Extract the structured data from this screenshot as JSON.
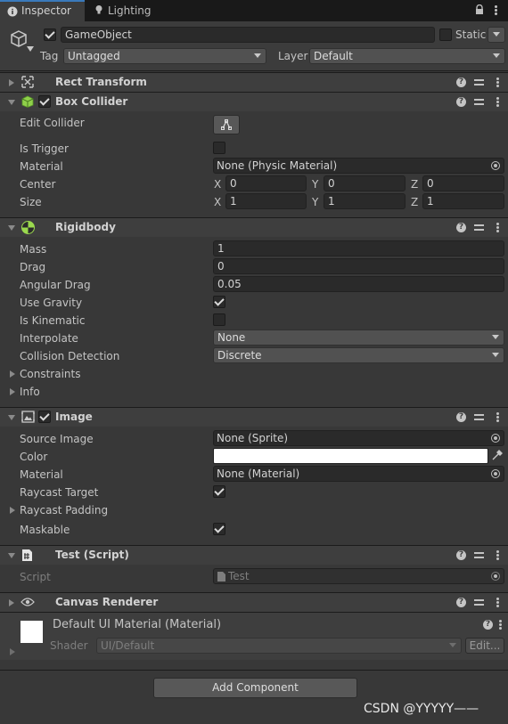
{
  "tabs": [
    {
      "label": "Inspector",
      "icon": "info-icon",
      "active": true
    },
    {
      "label": "Lighting",
      "icon": "lightbulb-icon",
      "active": false
    }
  ],
  "header": {
    "name": "GameObject",
    "static_label": "Static",
    "tag_label": "Tag",
    "tag_value": "Untagged",
    "layer_label": "Layer",
    "layer_value": "Default"
  },
  "rect_transform": {
    "title": "Rect Transform"
  },
  "box_collider": {
    "title": "Box Collider",
    "edit_collider": "Edit Collider",
    "is_trigger": "Is Trigger",
    "material_label": "Material",
    "material_value": "None (Physic Material)",
    "center_label": "Center",
    "center": {
      "x": "0",
      "y": "0",
      "z": "0"
    },
    "size_label": "Size",
    "size": {
      "x": "1",
      "y": "1",
      "z": "1"
    },
    "axis_x": "X",
    "axis_y": "Y",
    "axis_z": "Z"
  },
  "rigidbody": {
    "title": "Rigidbody",
    "mass_label": "Mass",
    "mass": "1",
    "drag_label": "Drag",
    "drag": "0",
    "angular_drag_label": "Angular Drag",
    "angular_drag": "0.05",
    "use_gravity_label": "Use Gravity",
    "is_kinematic_label": "Is Kinematic",
    "interpolate_label": "Interpolate",
    "interpolate": "None",
    "collision_label": "Collision Detection",
    "collision": "Discrete",
    "constraints_label": "Constraints",
    "info_label": "Info"
  },
  "image": {
    "title": "Image",
    "source_image_label": "Source Image",
    "source_image": "None (Sprite)",
    "color_label": "Color",
    "color": "#ffffff",
    "material_label": "Material",
    "material": "None (Material)",
    "raycast_target_label": "Raycast Target",
    "raycast_padding_label": "Raycast Padding",
    "maskable_label": "Maskable"
  },
  "test_script": {
    "title": "Test (Script)",
    "script_label": "Script",
    "script_value": "Test"
  },
  "canvas_renderer": {
    "title": "Canvas Renderer"
  },
  "material_section": {
    "name": "Default UI Material (Material)",
    "shader_label": "Shader",
    "shader_value": "UI/Default",
    "edit_label": "Edit..."
  },
  "add_component": "Add Component",
  "watermark": "CSDN @YYYYY——",
  "colors": {
    "accent": "#3a79bb",
    "panel": "#383838",
    "header": "#3e3e3e"
  }
}
